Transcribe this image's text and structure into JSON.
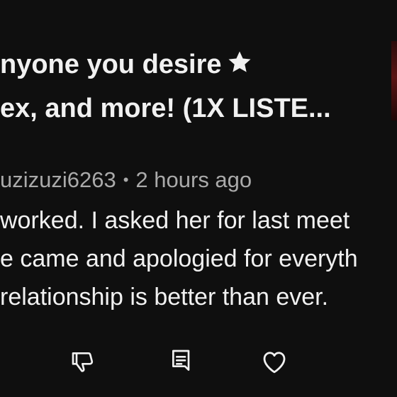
{
  "title": {
    "line1": "nyone you desire",
    "line2": "ex, and more! (1X LISTE..."
  },
  "comment": {
    "author": "uzizuzi6263",
    "separator": "•",
    "time": "2 hours ago",
    "lines": [
      "worked. I asked her for last meet",
      "e came and apologied for everyth",
      " relationship is better than ever."
    ]
  },
  "icons": {
    "star": "star-icon",
    "dislike": "thumbs-down-icon",
    "reply": "comment-icon",
    "like": "heart-icon"
  },
  "colors": {
    "background": "#0f0f0f",
    "text": "#f1f1f1",
    "meta": "#aaaaaa"
  }
}
